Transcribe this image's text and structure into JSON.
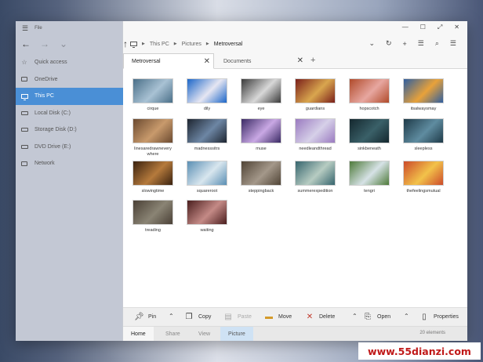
{
  "app": {
    "title": "File",
    "window_controls": [
      "—",
      "☐",
      "⤢",
      "✕"
    ]
  },
  "nav": {
    "back": "←",
    "forward": "→",
    "dropdown": "⌄",
    "up": "↑"
  },
  "sidebar": {
    "items": [
      {
        "label": "Quick access",
        "icon": "star-icon"
      },
      {
        "label": "OneDrive",
        "icon": "cloud-icon"
      },
      {
        "label": "This PC",
        "icon": "monitor-icon",
        "active": true
      },
      {
        "label": "Local Disk (C:)",
        "icon": "disk-icon"
      },
      {
        "label": "Storage Disk (D:)",
        "icon": "disk-icon"
      },
      {
        "label": "DVD Drive (E:)",
        "icon": "dvd-icon"
      },
      {
        "label": "Network",
        "icon": "network-icon"
      }
    ]
  },
  "address": {
    "crumbs": [
      "This PC",
      "Pictures",
      "Metroversal"
    ],
    "actions": [
      "⌄",
      "↻",
      "+",
      "☰",
      "⌕",
      "☰"
    ]
  },
  "tabs": [
    {
      "label": "Metroversal",
      "close": "✕"
    },
    {
      "label": "Documents",
      "close": "✕"
    }
  ],
  "tab_add": "+",
  "files": [
    {
      "name": "cirque",
      "colors": [
        "#4a6f88",
        "#a9c2d4"
      ]
    },
    {
      "name": "dily",
      "colors": [
        "#1c66c8",
        "#e6e6f2"
      ]
    },
    {
      "name": "eye",
      "colors": [
        "#3a3a3a",
        "#d8d8d8"
      ]
    },
    {
      "name": "guardians",
      "colors": [
        "#7a1f1a",
        "#d9a64e"
      ]
    },
    {
      "name": "hopscotch",
      "colors": [
        "#b04a2a",
        "#e7a7a0"
      ]
    },
    {
      "name": "itsalwaysmay",
      "colors": [
        "#2e5ea0",
        "#e8a23a"
      ]
    },
    {
      "name": "linesaredrawnevery where",
      "colors": [
        "#6b4a30",
        "#c89a6c"
      ]
    },
    {
      "name": "madnesssitrs",
      "colors": [
        "#1e2530",
        "#6d86a4"
      ]
    },
    {
      "name": "muse",
      "colors": [
        "#3a2a64",
        "#c9a8e4"
      ]
    },
    {
      "name": "needleandthread",
      "colors": [
        "#9a7ac0",
        "#d6d0e8"
      ]
    },
    {
      "name": "sinkbeneath",
      "colors": [
        "#14272e",
        "#3a6068"
      ]
    },
    {
      "name": "sleepless",
      "colors": [
        "#1e3a48",
        "#5f8ca0"
      ]
    },
    {
      "name": "slowingtime",
      "colors": [
        "#3a220f",
        "#b57a3c"
      ]
    },
    {
      "name": "squareroot",
      "colors": [
        "#5a8fb4",
        "#d8e6ee"
      ]
    },
    {
      "name": "steppingback",
      "colors": [
        "#504436",
        "#a4988a"
      ]
    },
    {
      "name": "summerexpedition",
      "colors": [
        "#36656e",
        "#b7ccc2"
      ]
    },
    {
      "name": "tengri",
      "colors": [
        "#4e7a3a",
        "#d6e2e6"
      ]
    },
    {
      "name": "thefeelingsmutual",
      "colors": [
        "#cc4a2a",
        "#f2c24a"
      ]
    },
    {
      "name": "treading",
      "colors": [
        "#4a4036",
        "#8a8474"
      ]
    },
    {
      "name": "waiting",
      "colors": [
        "#4a1e1e",
        "#c48a86"
      ]
    }
  ],
  "ribbon": {
    "pin": "Pin",
    "copy": "Copy",
    "paste": "Paste",
    "move": "Move",
    "delete": "Delete",
    "open": "Open",
    "properties": "Properties"
  },
  "bottom_tabs": [
    "Home",
    "Share",
    "View",
    "Picture"
  ],
  "status": "20 elements",
  "watermark": "www.55dianzi.com"
}
